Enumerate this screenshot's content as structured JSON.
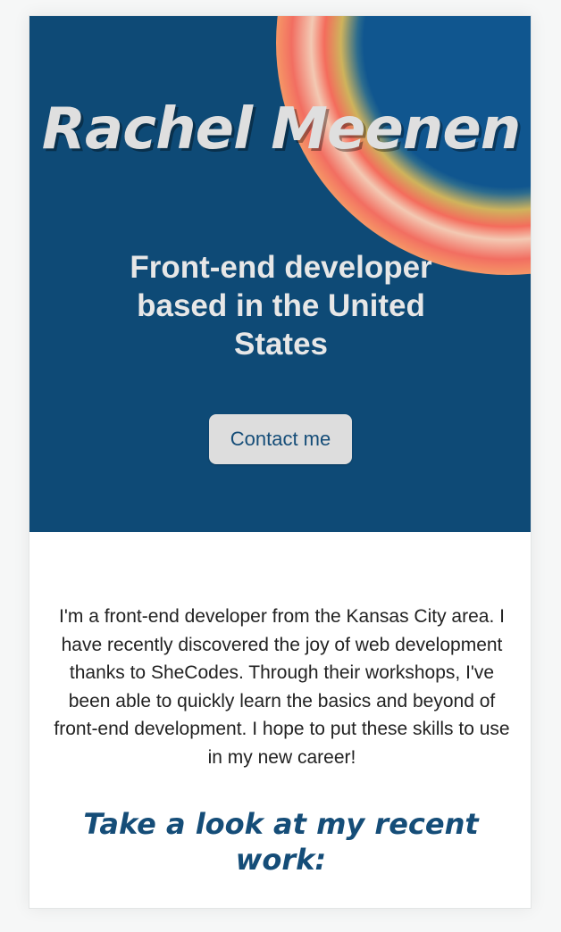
{
  "hero": {
    "name": "Rachel Meenen",
    "tagline": "Front-end developer based in the United States",
    "contact_label": "Contact me"
  },
  "about": {
    "text": "I'm a front-end developer from the Kansas City area. I have recently discovered the joy of web development thanks to SheCodes. Through their workshops, I've been able to quickly learn the basics and beyond of front-end development. I hope to put these skills to use in my new career!"
  },
  "work": {
    "heading": "Take a look at my recent work:"
  },
  "colors": {
    "hero_background": "#0e4a76",
    "accent_text": "#154d78",
    "button_background": "#dddddd"
  }
}
